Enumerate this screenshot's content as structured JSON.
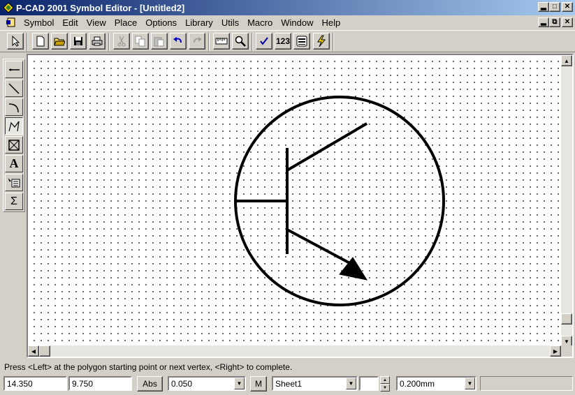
{
  "window": {
    "title": "P-CAD 2001 Symbol Editor - [Untitled2]"
  },
  "menu": {
    "items": [
      "Symbol",
      "Edit",
      "View",
      "Place",
      "Options",
      "Library",
      "Utils",
      "Macro",
      "Window",
      "Help"
    ]
  },
  "toolbar": {
    "buttons": [
      "select-arrow-icon",
      "new-file-icon",
      "open-folder-icon",
      "save-icon",
      "print-icon",
      "cut-icon",
      "copy-icon",
      "paste-icon",
      "undo-icon",
      "redo-icon",
      "measure-icon",
      "zoom-icon",
      "validate-check-icon",
      "renumber-icon",
      "pin-table-icon",
      "lightning-icon"
    ],
    "renumber_label": "123"
  },
  "left_tools": {
    "buttons": [
      "place-pin-icon",
      "place-line-icon",
      "place-arc-icon",
      "place-polygon-icon",
      "place-field-icon",
      "place-text-icon",
      "place-attribute-icon",
      "sum-icon"
    ],
    "text_glyph": "A",
    "sum_glyph": "Σ",
    "active": "place-polygon-icon"
  },
  "status": {
    "prompt": "Press <Left> at the polygon starting point or next vertex, <Right> to complete."
  },
  "bottom": {
    "x_coord": "14.350",
    "y_coord": "9.750",
    "abs_label": "Abs",
    "grid": "0.050",
    "m_label": "M",
    "sheet": "Sheet1",
    "line_width": "0.200mm"
  },
  "colors": {
    "title_start": "#0a246a",
    "title_end": "#a6caf0",
    "face": "#d4d0c8"
  }
}
